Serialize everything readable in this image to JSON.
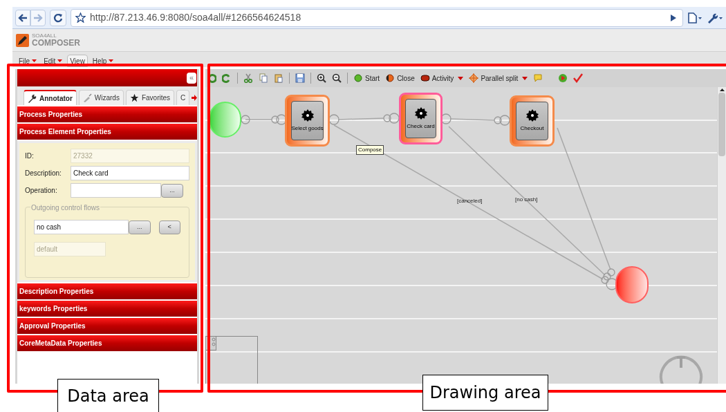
{
  "browser": {
    "url": "http://87.213.46.9:8080/soa4all/#1266564624518"
  },
  "app": {
    "brand_small": "SOA4ALL",
    "title": "COMPOSER"
  },
  "menu": [
    {
      "label": "File",
      "dropdown": true,
      "selected": false
    },
    {
      "label": "Edit",
      "dropdown": true,
      "selected": false
    },
    {
      "label": "View",
      "dropdown": false,
      "selected": true
    },
    {
      "label": "Help",
      "dropdown": true,
      "selected": false
    }
  ],
  "panel": {
    "collapse": "«",
    "tabs": [
      {
        "label": "Annotator",
        "selected": true
      },
      {
        "label": "Wizards",
        "selected": false
      },
      {
        "label": "Favorites",
        "selected": false
      },
      {
        "label": "C",
        "selected": false
      }
    ],
    "sections": [
      {
        "title": "Process Properties"
      },
      {
        "title": "Process Element Properties",
        "form": {
          "fields": [
            {
              "label": "ID:",
              "value": "27332",
              "disabled": true
            },
            {
              "label": "Description:",
              "value": "Check card",
              "disabled": false
            },
            {
              "label": "Operation:",
              "disabled": false,
              "button": "..."
            }
          ],
          "flows": {
            "legend": "Outgoing control flows",
            "value": "no cash",
            "buttons": [
              "...",
              "<"
            ],
            "default": "default"
          }
        }
      },
      {
        "title": "Description Properties"
      },
      {
        "title": "keywords Properties"
      },
      {
        "title": "Approval Properties"
      },
      {
        "title": "CoreMetaData Properties"
      }
    ]
  },
  "toolbar": [
    {
      "label": "Start",
      "dropdown": false
    },
    {
      "label": "Close",
      "dropdown": false
    },
    {
      "label": "Activity",
      "dropdown": true
    },
    {
      "label": "Parallel split",
      "dropdown": true
    }
  ],
  "diagram": {
    "nodes": [
      {
        "kind": "start",
        "selected": false
      },
      {
        "kind": "activity",
        "label": "Select goods",
        "selected": false
      },
      {
        "kind": "activity",
        "label": "Check card",
        "selected": true
      },
      {
        "kind": "activity",
        "label": "Checkout",
        "selected": false
      },
      {
        "kind": "end",
        "selected": false
      }
    ],
    "tooltip": "Compose",
    "flow_labels": [
      "[canceled]",
      "[no cash]"
    ]
  },
  "annotations": [
    {
      "label": "Data area"
    },
    {
      "label": "Drawing area"
    }
  ]
}
